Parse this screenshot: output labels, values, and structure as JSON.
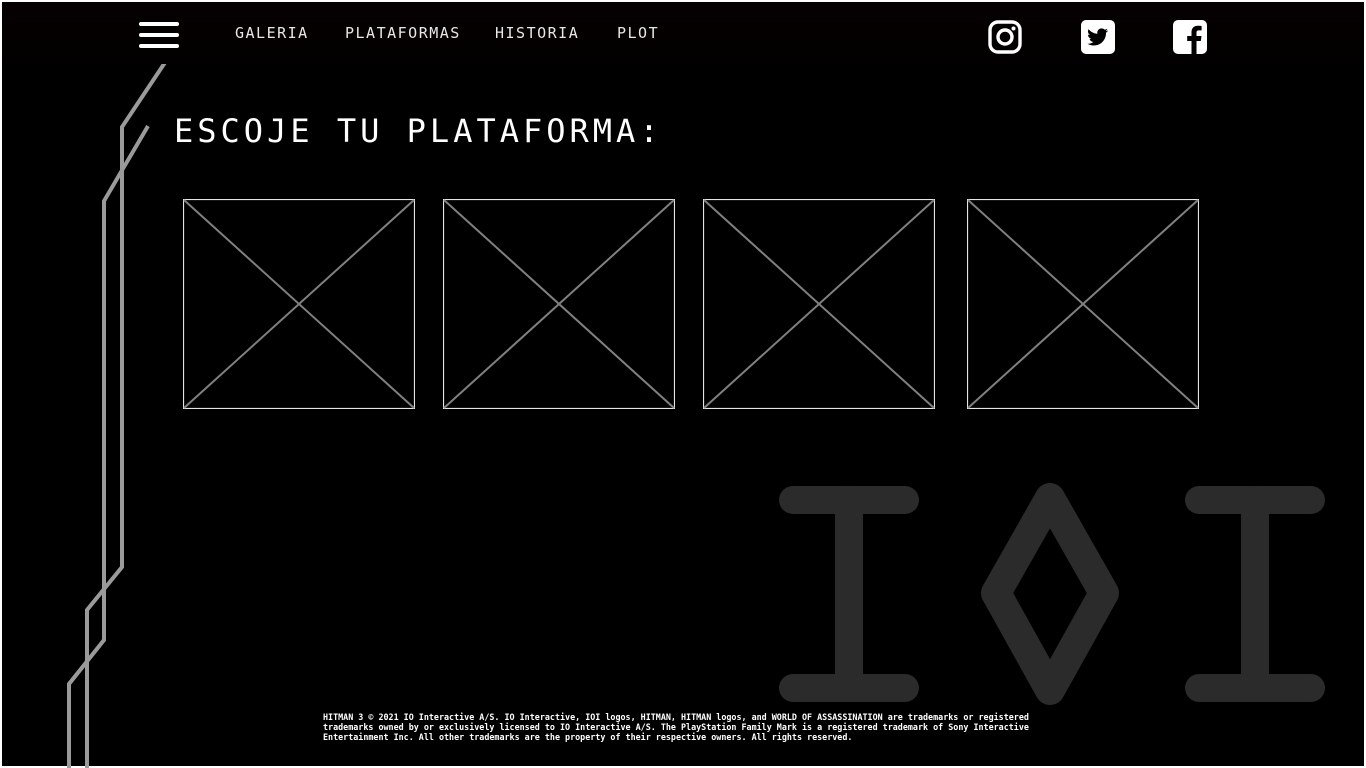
{
  "nav": {
    "menu_icon": "hamburger-icon",
    "links": [
      "GALERIA",
      "PLATAFORMAS",
      "HISTORIA",
      "PLOT"
    ],
    "social": [
      {
        "icon": "instagram-icon"
      },
      {
        "icon": "twitter-icon"
      },
      {
        "icon": "facebook-icon"
      }
    ]
  },
  "main": {
    "heading": "ESCOJE TU PLATAFORMA:",
    "platform_cards": [
      {
        "icon": "image-placeholder-icon"
      },
      {
        "icon": "image-placeholder-icon"
      },
      {
        "icon": "image-placeholder-icon"
      },
      {
        "icon": "image-placeholder-icon"
      }
    ]
  },
  "background": {
    "logo_text": "IOI",
    "logo_color": "#2b2b2b"
  },
  "footer": {
    "legal": "HITMAN 3 © 2021 IO Interactive A/S. IO Interactive, IOI logos, HITMAN, HITMAN logos, and WORLD OF ASSASSINATION are trademarks or registered trademarks owned by or exclusively licensed to IO Interactive A/S. The PlayStation Family Mark is a registered trademark of Sony Interactive Entertainment Inc. All other trademarks are the property of their respective owners. All rights reserved."
  },
  "colors": {
    "background": "#000000",
    "text": "#ffffff",
    "placeholder_line": "#808080",
    "deco_line": "#9a9a9a"
  }
}
